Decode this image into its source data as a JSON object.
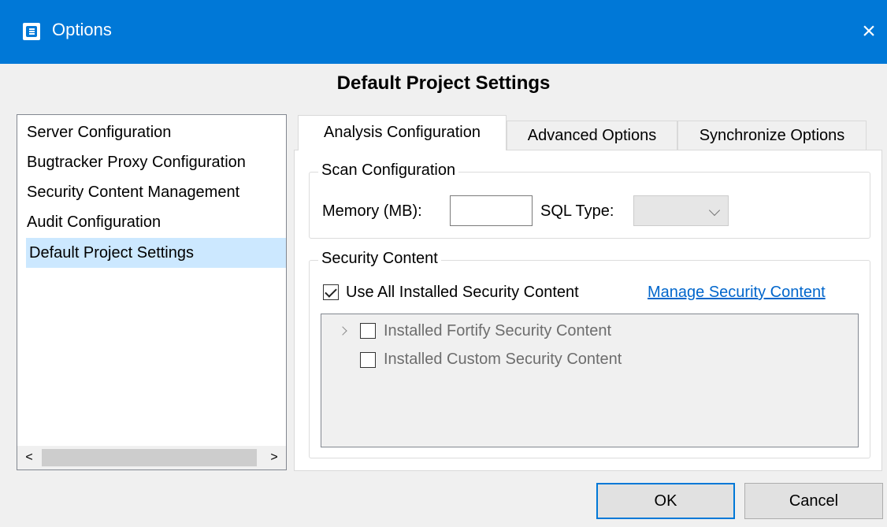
{
  "window": {
    "title": "Options",
    "close_icon": "×"
  },
  "header": {
    "title": "Default Project Settings"
  },
  "sidebar": {
    "items": [
      {
        "label": "Server Configuration"
      },
      {
        "label": "Bugtracker Proxy Configuration"
      },
      {
        "label": "Security Content Management"
      },
      {
        "label": "Audit Configuration"
      },
      {
        "label": "Default Project Settings",
        "selected": true
      }
    ],
    "scroll_left": "<",
    "scroll_right": ">"
  },
  "tabs": [
    {
      "label": "Analysis Configuration",
      "active": true
    },
    {
      "label": "Advanced Options"
    },
    {
      "label": "Synchronize Options"
    }
  ],
  "scan_config": {
    "title": "Scan Configuration",
    "memory_label": "Memory (MB):",
    "memory_value": "",
    "sql_type_label": "SQL Type:",
    "sql_type_value": ""
  },
  "security_content": {
    "title": "Security Content",
    "use_all_label": "Use All Installed Security Content",
    "use_all_checked": true,
    "manage_link": "Manage Security Content",
    "tree_items": [
      {
        "label": "Installed Fortify Security Content",
        "expandable": true,
        "checked": false
      },
      {
        "label": "Installed Custom Security Content",
        "expandable": false,
        "checked": false
      }
    ]
  },
  "buttons": {
    "ok": "OK",
    "cancel": "Cancel"
  },
  "colors": {
    "titlebar": "#0078d7",
    "selection": "#cce8ff",
    "link": "#0066cc"
  }
}
